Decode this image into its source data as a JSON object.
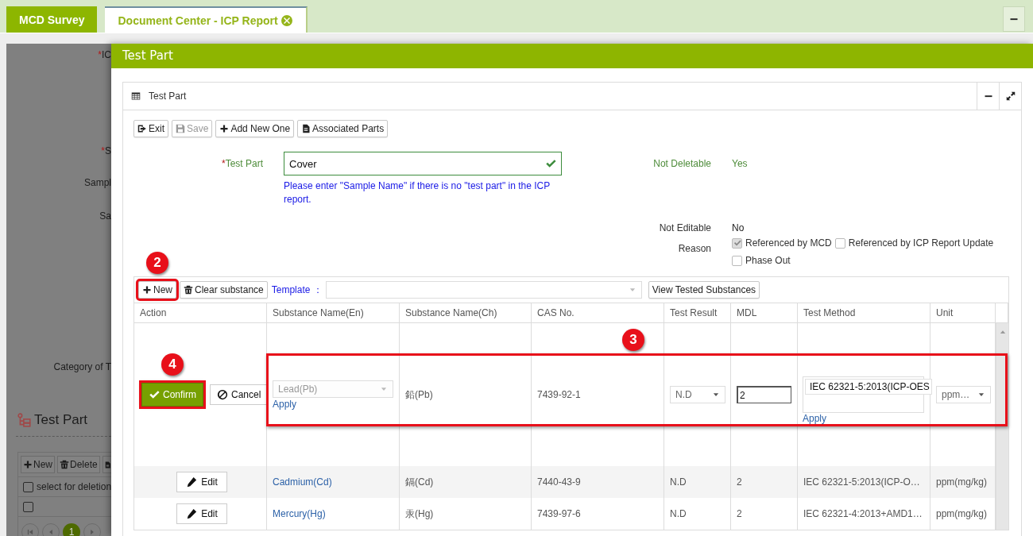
{
  "tabs": [
    {
      "label": "MCD Survey",
      "selected": false,
      "closable": false
    },
    {
      "label": "Document Center - ICP Report",
      "selected": true,
      "closable": true
    }
  ],
  "background_page": {
    "labels": [
      {
        "mark": "*",
        "text": "IC"
      },
      {
        "mark": "*",
        "text": "S"
      },
      {
        "text": "Sampl"
      },
      {
        "text": "Sa"
      },
      {
        "text": "Category of T"
      }
    ],
    "section_title": "Test Part",
    "toolbar": [
      {
        "kind": "add",
        "label": "New"
      },
      {
        "kind": "delete",
        "label": "Delete"
      },
      {
        "kind": "export"
      }
    ],
    "select_all": {
      "label": "select for deletion",
      "checked": false
    },
    "rows": [
      {
        "checked": false
      }
    ],
    "pager": {
      "page": "1"
    }
  },
  "dialog": {
    "title": "Test Part",
    "panel_title": "Test Part",
    "toolbar": [
      {
        "kind": "exit",
        "label": "Exit",
        "disabled": false
      },
      {
        "kind": "save",
        "label": "Save",
        "disabled": true
      },
      {
        "kind": "add",
        "label": "Add New One",
        "disabled": false
      },
      {
        "kind": "document",
        "label": "Associated Parts",
        "disabled": false
      }
    ],
    "test_part": {
      "mark": "*",
      "label": "Test Part",
      "value": "Cover",
      "valid": true,
      "hint": "Please enter \"Sample Name\" if there is no \"test part\" in the ICP report."
    },
    "not_deletable": {
      "label": "Not Deletable",
      "value": "Yes",
      "valid": true
    },
    "not_editable": {
      "label": "Not Editable",
      "value": "No",
      "valid": false
    },
    "reason": {
      "label": "Reason",
      "options": [
        {
          "label": "Referenced by MCD",
          "checked": true,
          "disabled": true
        },
        {
          "label": "Referenced by ICP Report Update",
          "checked": false,
          "disabled": false
        },
        {
          "label": "Phase Out",
          "checked": false,
          "disabled": false
        }
      ]
    },
    "substances": {
      "toolbar": [
        {
          "kind": "add",
          "label": "New",
          "callout": "2"
        },
        {
          "kind": "delete",
          "label": "Clear substance"
        }
      ],
      "template_label": "Template ：",
      "view_button": "View Tested Substances",
      "columns": [
        "Action",
        "Substance Name(En)",
        "Substance Name(Ch)",
        "CAS No.",
        "Test Result",
        "MDL",
        "Test Method",
        "Unit"
      ],
      "rows": [
        {
          "kind": "editing",
          "callout": "3",
          "confirm": "Confirm",
          "confirm_callout": "4",
          "cancel": "Cancel",
          "substance_en": "Lead(Pb)",
          "substance_en_disabled": true,
          "apply": "Apply",
          "substance_ch": "鉛(Pb)",
          "cas": "7439-92-1",
          "test_result": "N.D",
          "mdl": "2",
          "test_method": "IEC 62321-5:2013(ICP-OES",
          "method_apply": "Apply",
          "unit": "ppm…"
        },
        {
          "kind": "view",
          "action": "Edit",
          "substance_en": "Cadmium(Cd)",
          "substance_ch": "鎘(Cd)",
          "cas": "7440-43-9",
          "test_result": "N.D",
          "mdl": "2",
          "test_method": "IEC 62321-5:2013(ICP-O…",
          "unit": "ppm(mg/kg)"
        },
        {
          "kind": "view",
          "action": "Edit",
          "substance_en": "Mercury(Hg)",
          "substance_ch": "汞(Hg)",
          "cas": "7439-97-6",
          "test_result": "N.D",
          "mdl": "2",
          "test_method": "IEC 62321-4:2013+AMD1…",
          "unit": "ppm(mg/kg)"
        }
      ]
    }
  }
}
